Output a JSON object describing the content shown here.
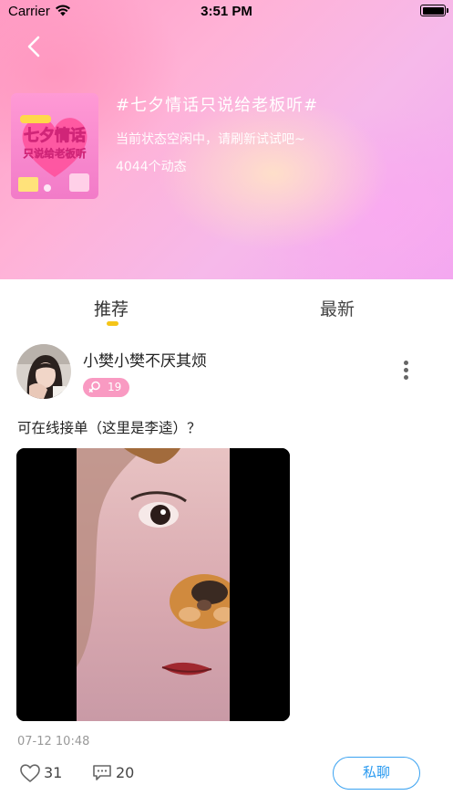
{
  "status_bar": {
    "carrier": "Carrier",
    "time": "3:51 PM",
    "wifi_icon": "wifi-icon",
    "battery_icon": "battery-icon"
  },
  "header": {
    "back_icon": "chevron-left-icon",
    "cover_text_line1": "七夕情话",
    "cover_text_line2": "只说给老板听",
    "topic_title": "#七夕情话只说给老板听#",
    "status_text": "当前状态空闲中，请刷新试试吧~",
    "post_count": "4044个动态"
  },
  "tabs": [
    {
      "label": "推荐",
      "active": true
    },
    {
      "label": "最新",
      "active": false
    }
  ],
  "post": {
    "username": "小樊小樊不厌其烦",
    "gender_icon": "female-icon",
    "age": "19",
    "text": "可在线接单（这里是李逵）？",
    "time": "07-12 10:48",
    "likes": "31",
    "comments": "20",
    "chat_label": "私聊",
    "more_icon": "more-vertical-icon",
    "like_icon": "heart-icon",
    "comment_icon": "comment-icon"
  },
  "colors": {
    "accent_yellow": "#f5c518",
    "chat_blue": "#3aa2f1",
    "badge_pink": "#f99ac2",
    "header_pink": "#ffb2d6"
  }
}
